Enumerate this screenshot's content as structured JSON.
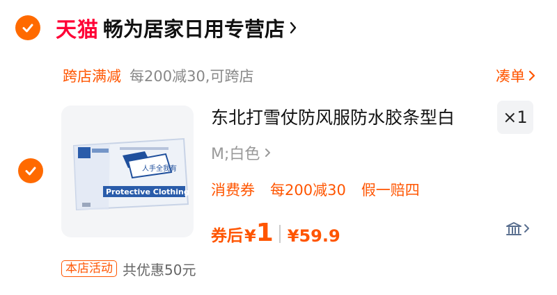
{
  "shop": {
    "platform_logo": "天猫",
    "name": "畅为居家日用专营店"
  },
  "promo": {
    "tag": "跨店满减",
    "desc": "每200减30,可跨店",
    "action": "凑单"
  },
  "product": {
    "image_label": "Protective Clothing",
    "image_stamp": "人手全我有",
    "title": "东北打雪仗防风服防水胶条型白",
    "quantity": "×1",
    "sku": "M;白色",
    "coupon_tag": "消费券",
    "coupon_desc": "每200减30",
    "guarantee": "假一赔四",
    "after_coupon_label": "券后",
    "currency": "¥",
    "after_coupon_price": "1",
    "original_price": "¥59.9"
  },
  "store_activity": {
    "tag": "本店活动",
    "desc": "共优惠50元"
  },
  "colors": {
    "accent": "#ff6a00",
    "tmall_red": "#ff0036",
    "promo_orange": "#ff5500"
  },
  "icons": [
    "check-icon",
    "chevron-right-icon",
    "price-history-icon"
  ]
}
